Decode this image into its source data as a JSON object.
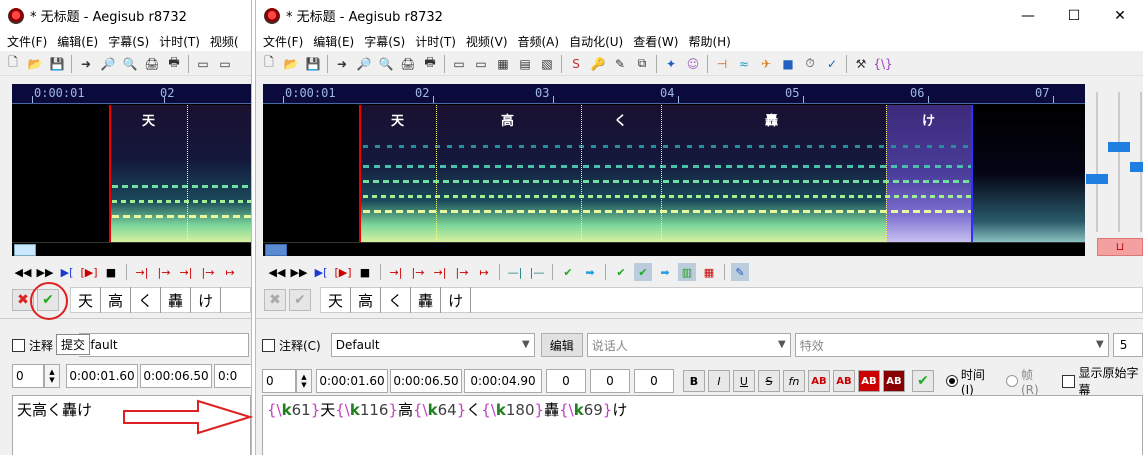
{
  "left_window": {
    "title": "* 无标题 - Aegisub r8732",
    "menu": [
      "文件(F)",
      "编辑(E)",
      "字幕(S)",
      "计时(T)",
      "视频("
    ],
    "timeline_labels": [
      "0:00:01",
      "02"
    ],
    "syllables": [
      "天"
    ],
    "karaoke_syllables": [
      "天",
      "高",
      "く",
      "轟",
      "け"
    ],
    "style_label": "注释",
    "style_value": "efault",
    "tooltip": "提交",
    "layer": "0",
    "start_time": "0:00:01.60",
    "end_time": "0:00:06.50",
    "duration_partial": "0:0",
    "text": "天高く轟け"
  },
  "right_window": {
    "title": "* 无标题 - Aegisub r8732",
    "window_buttons": [
      "—",
      "☐",
      "✕"
    ],
    "menu": [
      "文件(F)",
      "编辑(E)",
      "字幕(S)",
      "计时(T)",
      "视频(V)",
      "音频(A)",
      "自动化(U)",
      "查看(W)",
      "帮助(H)"
    ],
    "timeline_labels": [
      "0:00:01",
      "02",
      "03",
      "04",
      "05",
      "06",
      "07"
    ],
    "syllables": [
      "天",
      "高",
      "く",
      "轟",
      "け"
    ],
    "karaoke_syllables": [
      "天",
      "高",
      "く",
      "轟",
      "け"
    ],
    "comment_label": "注释(C)",
    "style_value": "Default",
    "edit_button": "编辑",
    "actor_placeholder": "说话人",
    "effect_placeholder": "特效",
    "layer_partial": "5",
    "layer": "0",
    "start_time": "0:00:01.60",
    "end_time": "0:00:06.50",
    "duration": "0:00:04.90",
    "margin_l": "0",
    "margin_r": "0",
    "margin_v": "0",
    "format_buttons": [
      "B",
      "I",
      "U",
      "S",
      "fn",
      "AB",
      "AB",
      "AB",
      "AB"
    ],
    "time_radio": "时间(I)",
    "frame_radio": "帧(R)",
    "show_original": "显示原始字幕",
    "text_segments": [
      {
        "k": "61",
        "s": "天"
      },
      {
        "k": "116",
        "s": "高"
      },
      {
        "k": "64",
        "s": "く"
      },
      {
        "k": "180",
        "s": "轟"
      },
      {
        "k": "69",
        "s": "け"
      }
    ]
  },
  "colors": {
    "start_marker": "#e00000",
    "end_marker": "#3030ff",
    "karaoke_divider": "#ffff66",
    "annotation_red": "#e02020"
  }
}
